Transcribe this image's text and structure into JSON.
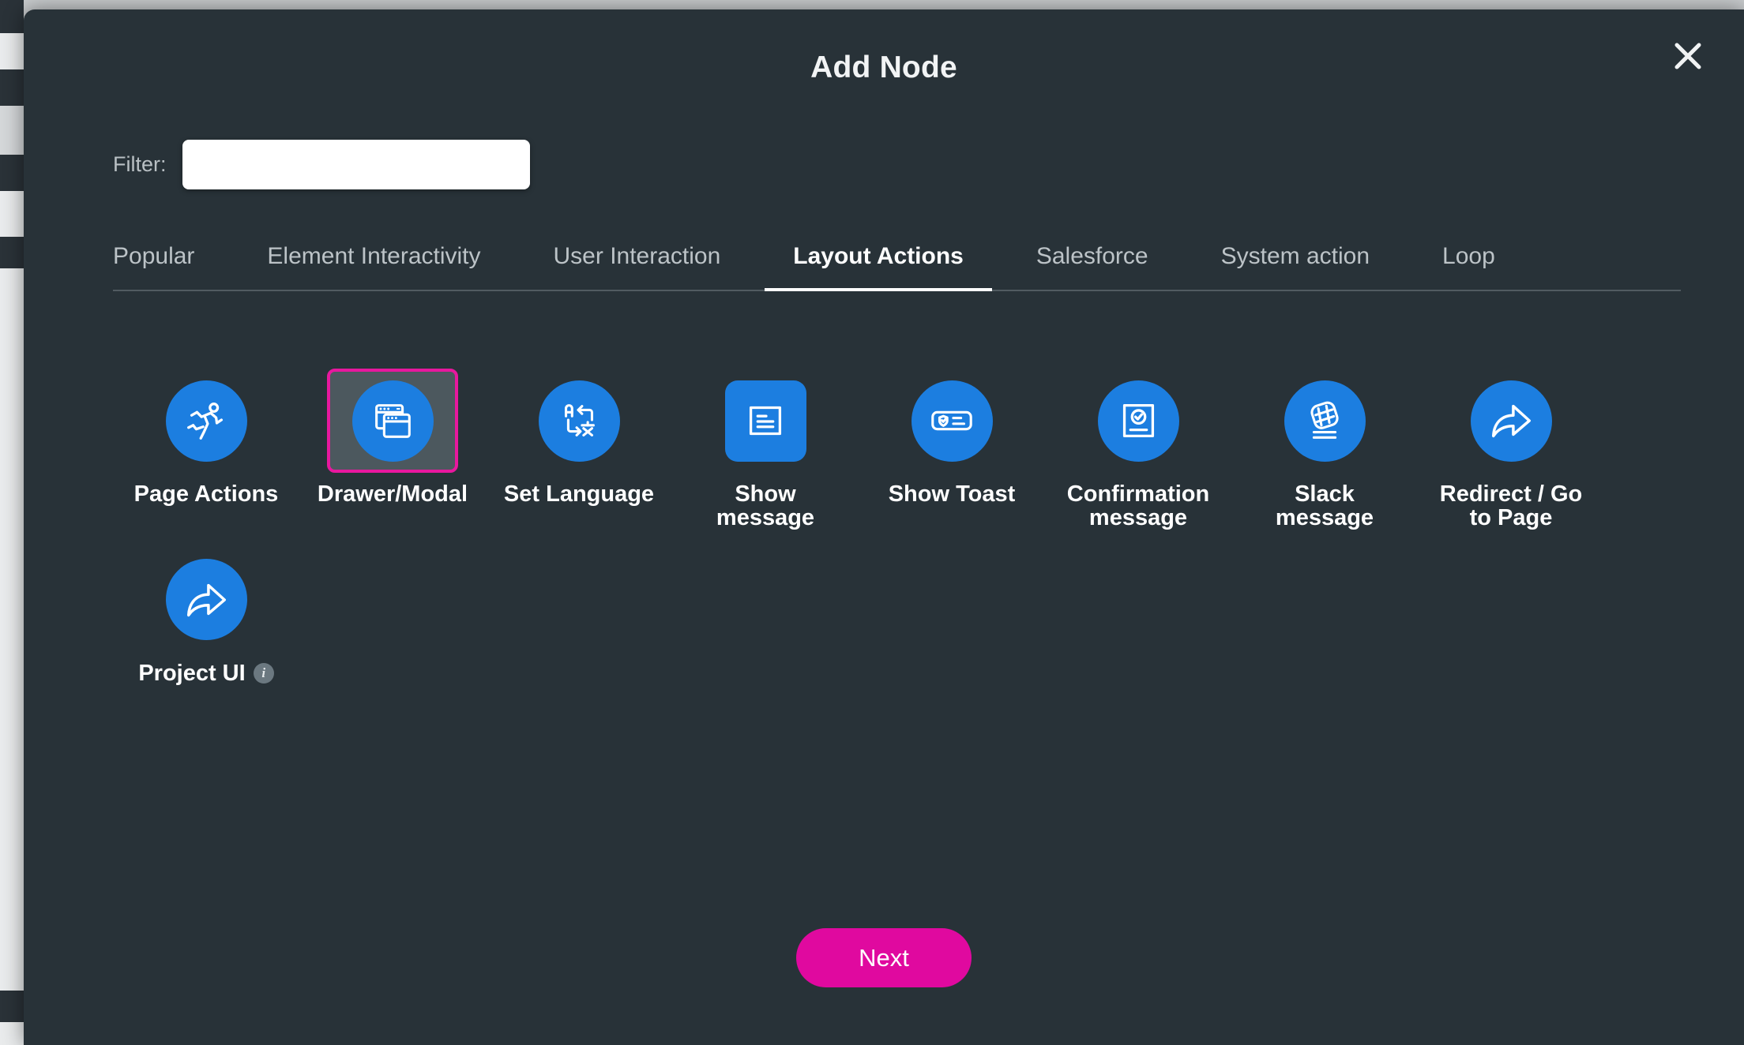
{
  "modal": {
    "title": "Add Node",
    "close_icon": "close-icon",
    "filter": {
      "label": "Filter:",
      "value": "",
      "placeholder": ""
    },
    "next_label": "Next"
  },
  "tabs": [
    {
      "label": "Popular",
      "active": false
    },
    {
      "label": "Element Interactivity",
      "active": false
    },
    {
      "label": "User Interaction",
      "active": false
    },
    {
      "label": "Layout Actions",
      "active": true
    },
    {
      "label": "Salesforce",
      "active": false
    },
    {
      "label": "System action",
      "active": false
    },
    {
      "label": "Loop",
      "active": false
    }
  ],
  "nodes": [
    {
      "label": "Page Actions",
      "icon": "running-person-icon",
      "shape": "circle",
      "selected": false,
      "info": false
    },
    {
      "label": "Drawer/Modal",
      "icon": "windows-stack-icon",
      "shape": "circle",
      "selected": true,
      "info": false
    },
    {
      "label": "Set Language",
      "icon": "translate-icon",
      "shape": "circle",
      "selected": false,
      "info": false
    },
    {
      "label": "Show\nmessage",
      "icon": "message-box-icon",
      "shape": "rounded",
      "selected": false,
      "info": false
    },
    {
      "label": "Show Toast",
      "icon": "toast-shield-icon",
      "shape": "circle",
      "selected": false,
      "info": false
    },
    {
      "label": "Confirmation\nmessage",
      "icon": "check-card-icon",
      "shape": "circle",
      "selected": false,
      "info": false
    },
    {
      "label": "Slack\nmessage",
      "icon": "slack-hash-icon",
      "shape": "circle",
      "selected": false,
      "info": false
    },
    {
      "label": "Redirect / Go\nto Page",
      "icon": "redirect-arrow-icon",
      "shape": "circle",
      "selected": false,
      "info": false
    },
    {
      "label": "Project UI",
      "icon": "redirect-arrow-icon",
      "shape": "circle",
      "selected": false,
      "info": true,
      "info_label": "i"
    }
  ],
  "colors": {
    "modal_bg": "#283238",
    "icon_blue": "#1c7ee0",
    "accent_pink": "#e8189e",
    "next_pink": "#e0099f",
    "selected_tile": "#4c585e"
  }
}
